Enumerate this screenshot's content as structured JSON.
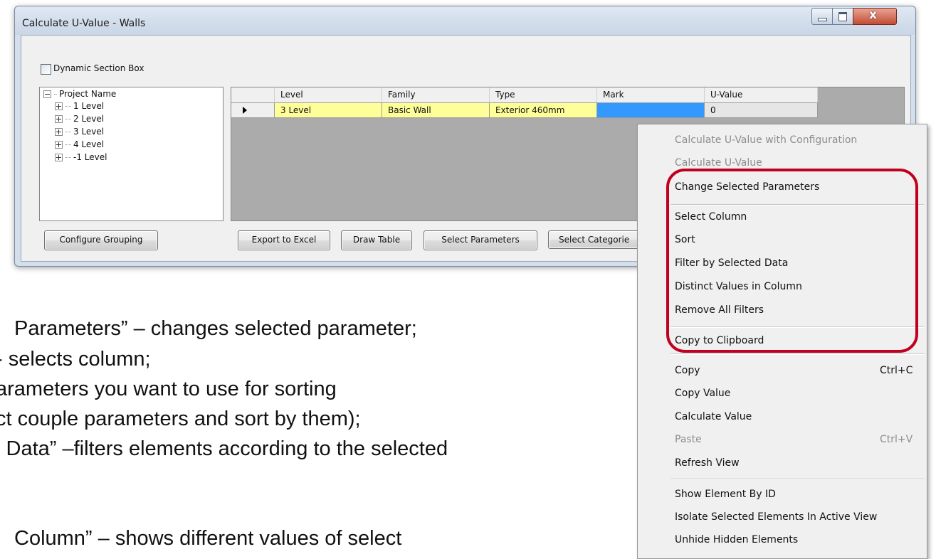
{
  "window": {
    "title": "Calculate U-Value - Walls",
    "controls": {
      "close": "x"
    }
  },
  "dynamic_section_box": {
    "label": "Dynamic Section Box",
    "checked": false
  },
  "tree": {
    "root": "Project Name",
    "children": [
      "1 Level",
      "2 Level",
      "3 Level",
      "4 Level",
      "-1 Level"
    ]
  },
  "grid": {
    "columns": [
      "Level",
      "Family",
      "Type",
      "Mark",
      "U-Value"
    ],
    "rows": [
      {
        "level": "3 Level",
        "family": "Basic Wall",
        "type": "Exterior 460mm",
        "mark": "",
        "u_value": "0"
      }
    ]
  },
  "buttons": {
    "configure_grouping": "Configure Grouping",
    "export_to_excel": "Export to Excel",
    "draw_table": "Draw Table",
    "select_parameters": "Select Parameters",
    "select_categories": "Select Categorie"
  },
  "context_menu": {
    "items": [
      {
        "label": "Calculate U-Value with Configuration",
        "enabled": false
      },
      {
        "label": "Calculate U-Value",
        "enabled": false
      },
      {
        "label": "Change Selected Parameters",
        "enabled": true
      },
      {
        "label": "Select Column",
        "enabled": true
      },
      {
        "label": "Sort",
        "enabled": true
      },
      {
        "label": "Filter by Selected Data",
        "enabled": true
      },
      {
        "label": "Distinct Values in Column",
        "enabled": true
      },
      {
        "label": "Remove All Filters",
        "enabled": true
      },
      {
        "label": "Copy to Clipboard",
        "enabled": true
      },
      {
        "label": "Copy",
        "shortcut": "Ctrl+C",
        "enabled": true
      },
      {
        "label": "Copy Value",
        "enabled": true
      },
      {
        "label": "Calculate Value",
        "enabled": true
      },
      {
        "label": "Paste",
        "shortcut": "Ctrl+V",
        "enabled": false
      },
      {
        "label": "Refresh View",
        "enabled": true
      },
      {
        "label": "Show Element By ID",
        "enabled": true
      },
      {
        "label": "Isolate Selected Elements In Active View",
        "enabled": true
      },
      {
        "label": "Unhide Hidden Elements",
        "enabled": true
      }
    ]
  },
  "slide_text": {
    "line1": "Parameters” – changes selected parameter;",
    "line2": "- selects column;",
    "line3": "arameters you want to use for sorting",
    "line4": "ct couple parameters and sort by them);",
    "line5": "l Data” –filters elements according to the selected",
    "line6": "Column” – shows different values of select"
  },
  "colors": {
    "selected_row": "#ffff99",
    "selected_cell": "#3399ff",
    "callout": "#c0001e"
  }
}
